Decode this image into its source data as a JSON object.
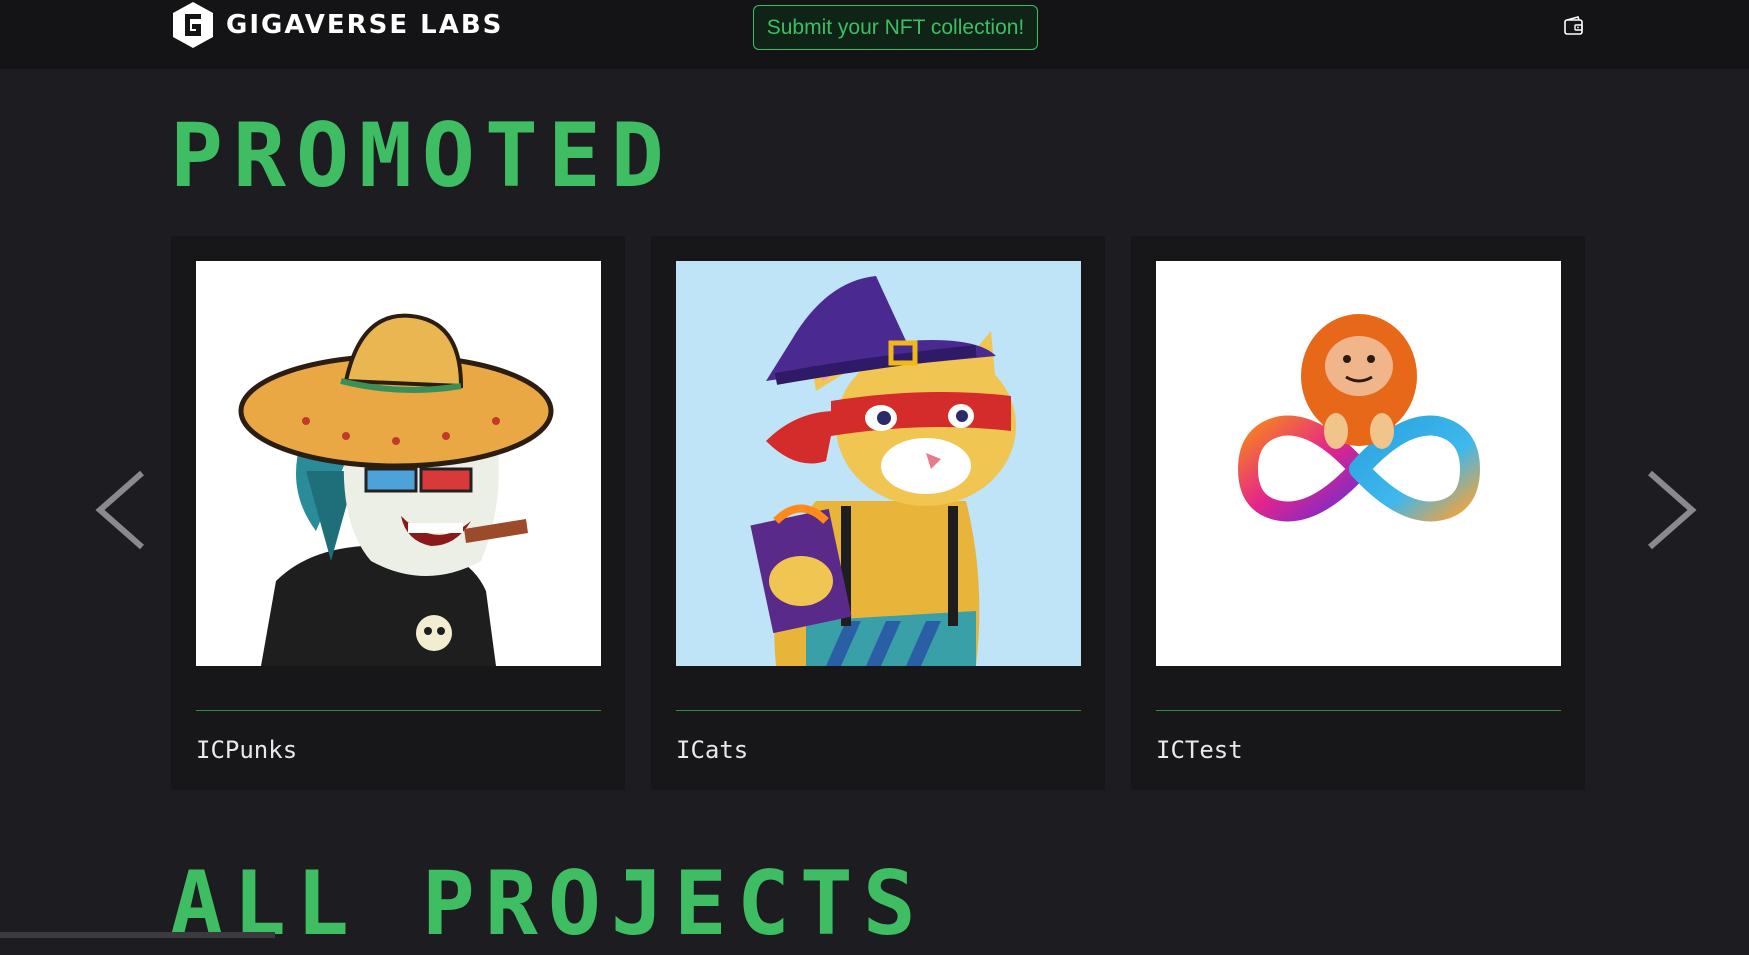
{
  "header": {
    "brand": "GIGAVERSE LABS",
    "submit_label": "Submit your NFT collection!",
    "logo_icon": "gigaverse-logo-icon",
    "wallet_icon": "wallet-icon"
  },
  "sections": {
    "promoted_title": "PROMOTED",
    "all_projects_title": "ALL PROJECTS"
  },
  "promoted": [
    {
      "name": "ICPunks",
      "image": "icpunks-image"
    },
    {
      "name": "ICats",
      "image": "icats-image"
    },
    {
      "name": "ICTest",
      "image": "ictest-image"
    }
  ],
  "carousel": {
    "prev_icon": "chevron-left-icon",
    "next_icon": "chevron-right-icon"
  },
  "colors": {
    "accent": "#3fbd63",
    "background": "#1d1d21",
    "header_bg": "#141416",
    "card_bg": "#17171a"
  }
}
